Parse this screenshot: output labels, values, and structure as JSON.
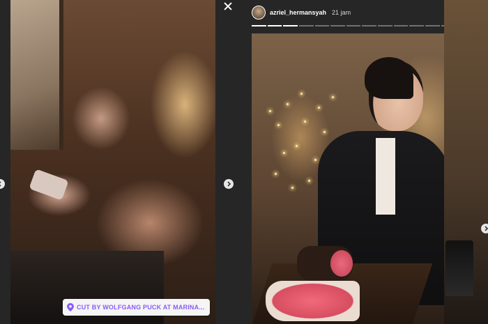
{
  "prev_story": {
    "location_sticker": "CUT BY WOLFGANG PUCK AT MARINA..."
  },
  "active_story": {
    "username": "azriel_hermansyah",
    "timestamp": "21 jam",
    "progress": {
      "segments": 14,
      "completed": 3
    }
  },
  "icons": [
    "close-icon",
    "more-icon",
    "chevron-right-icon",
    "chevron-left-icon",
    "location-pin-icon"
  ],
  "colors": {
    "background": "#262626",
    "sticker_text": "#8b5cf6"
  }
}
